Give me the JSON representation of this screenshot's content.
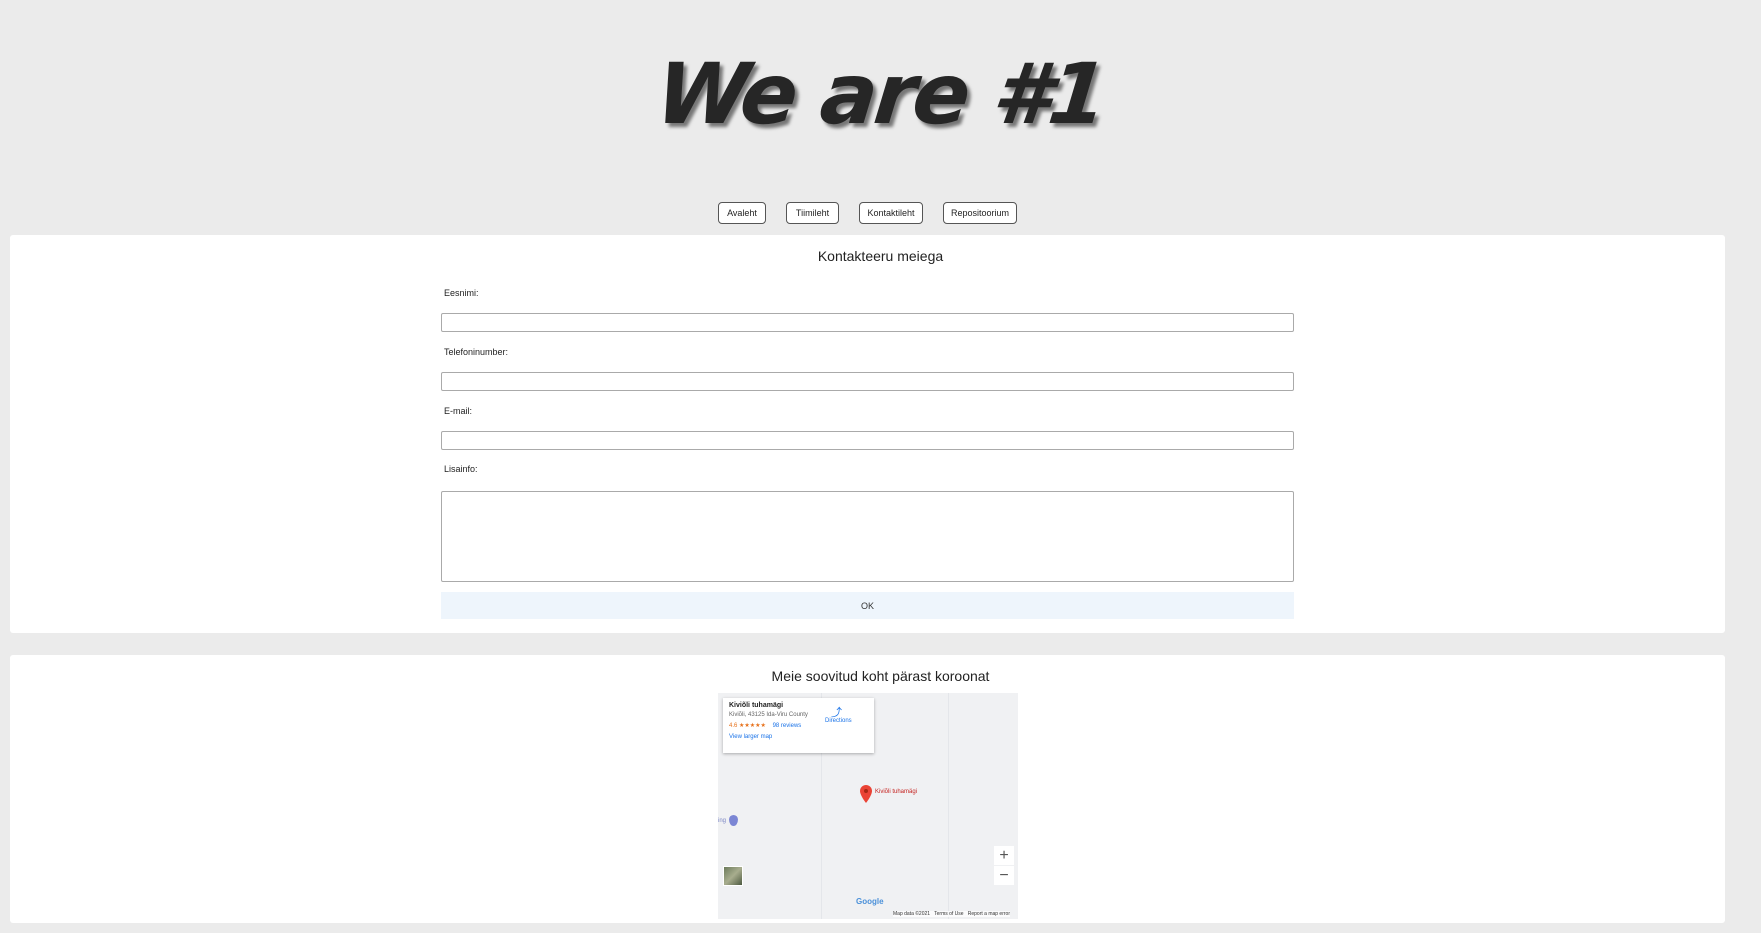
{
  "header": {
    "title": "We are #1"
  },
  "nav": [
    {
      "label": "Avaleht"
    },
    {
      "label": "Tiimileht"
    },
    {
      "label": "Kontaktileht"
    },
    {
      "label": "Repositoorium"
    }
  ],
  "contact": {
    "heading": "Kontakteeru meiega",
    "fields": [
      {
        "label": "Eesnimi:",
        "value": ""
      },
      {
        "label": "Telefoninumber:",
        "value": ""
      },
      {
        "label": "E-mail:",
        "value": ""
      },
      {
        "label": "Lisainfo:",
        "value": ""
      }
    ],
    "submit_label": "OK"
  },
  "map_section": {
    "heading": "Meie soovitud koht pärast koroonat",
    "place_name": "Kiviõli tuhamägi",
    "address": "Kiviõli, 43125 Ida-Viru County",
    "rating": "4.6",
    "stars": "★★★★★",
    "reviews": "98 reviews",
    "directions": "Directions",
    "larger_map": "View larger map",
    "marker_label": "Kiviõli tuhamägi",
    "side_label": "ing",
    "google": "Google",
    "map_data": "Map data ©2021",
    "terms": "Terms of Use",
    "report": "Report a map error",
    "zoom_in": "+",
    "zoom_out": "−",
    "marker_color": "#ea4335"
  }
}
